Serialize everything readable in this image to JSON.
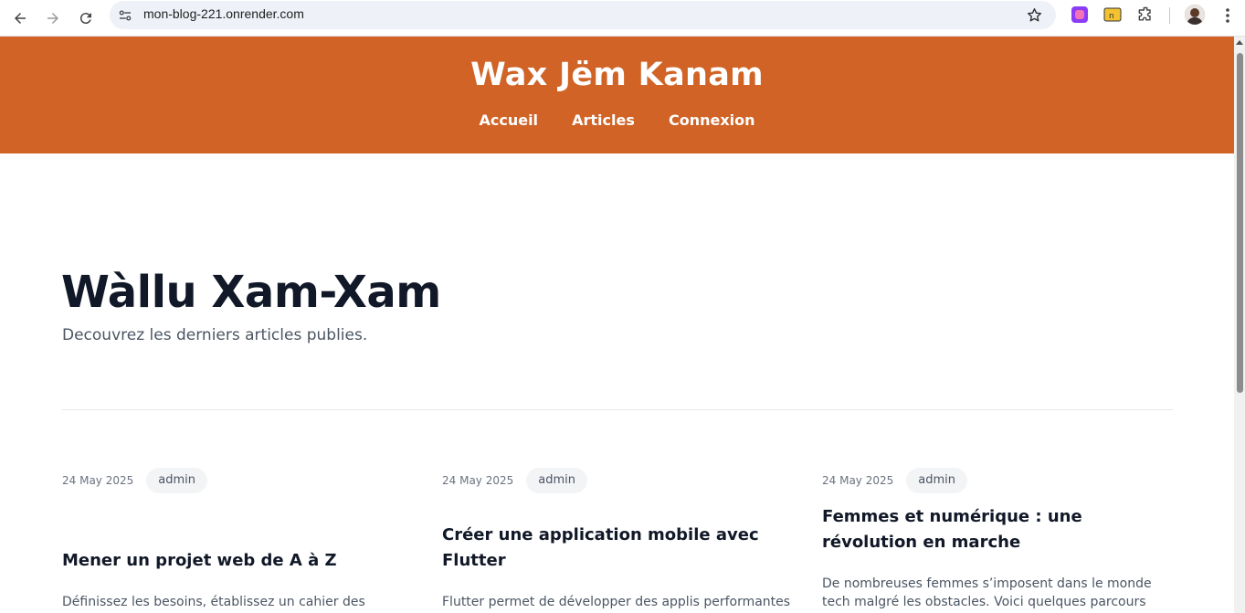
{
  "browser": {
    "url": "mon-blog-221.onrender.com",
    "icons": [
      "back-arrow-icon",
      "forward-arrow-icon",
      "reload-icon",
      "site-settings-icon",
      "bookmark-star-icon",
      "extension-icon",
      "extension-icon",
      "puzzle-extensions-icon",
      "profile-avatar",
      "menu-dots-icon"
    ]
  },
  "header": {
    "site_title": "Wax Jëm Kanam",
    "nav": [
      "Accueil",
      "Articles",
      "Connexion"
    ],
    "background_color": "#d06325"
  },
  "hero": {
    "title": "Wàllu Xam-Xam",
    "subtitle": "Decouvrez les derniers articles publies."
  },
  "articles": [
    {
      "date": "24 May 2025",
      "author": "admin",
      "title": "Mener un projet web de A à Z",
      "excerpt": "Définissez les besoins, établissez un cahier des"
    },
    {
      "date": "24 May 2025",
      "author": "admin",
      "title": "Créer une application mobile avec Flutter",
      "excerpt": "Flutter permet de développer des applis performantes"
    },
    {
      "date": "24 May 2025",
      "author": "admin",
      "title": "Femmes et numérique : une révolution en marche",
      "excerpt": "De nombreuses femmes s’imposent dans le monde tech malgré les obstacles. Voici quelques parcours"
    }
  ]
}
